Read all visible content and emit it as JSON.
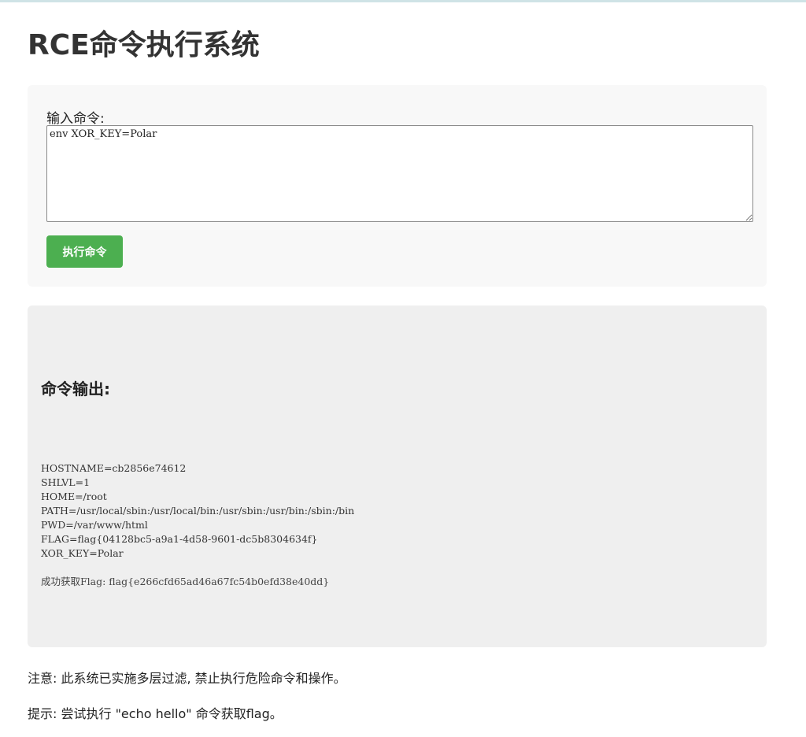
{
  "page": {
    "title": "RCE命令执行系统"
  },
  "form": {
    "label": "输入命令:",
    "command_value": "env XOR_KEY=Polar",
    "submit_label": "执行命令"
  },
  "output": {
    "title": "命令输出:",
    "lines": [
      "HOSTNAME=cb2856e74612",
      "SHLVL=1",
      "HOME=/root",
      "PATH=/usr/local/sbin:/usr/local/bin:/usr/sbin:/usr/bin:/sbin:/bin",
      "PWD=/var/www/html",
      "FLAG=flag{04128bc5-a9a1-4d58-9601-dc5b8304634f}",
      "XOR_KEY=Polar"
    ],
    "success_message": "成功获取Flag: flag{e266cfd65ad46a67fc54b0efd38e40dd}"
  },
  "notes": {
    "warning": "注意: 此系统已实施多层过滤, 禁止执行危险命令和操作。",
    "hint": "提示: 尝试执行 \"echo hello\" 命令获取flag。"
  },
  "colors": {
    "button": "#4caf50",
    "form_bg": "#f8f8f8",
    "output_bg": "#efefef"
  }
}
